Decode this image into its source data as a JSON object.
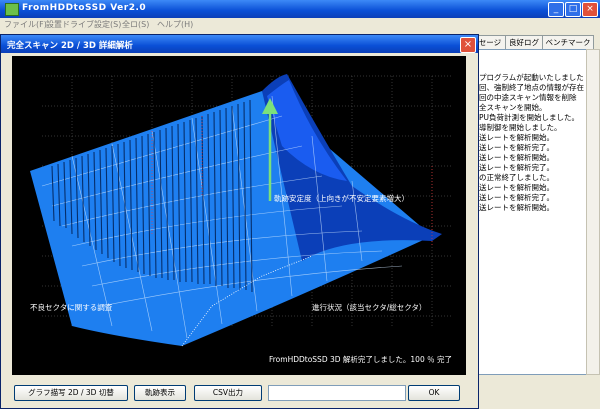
{
  "main_window": {
    "title": "FromHDDtoSSD Ver2.0",
    "menu": [
      "ファイル(F)",
      "設置ドライブ設定(S)",
      "全ロ(S)",
      "ヘルプ(H)"
    ],
    "minimize": "_",
    "maximize": "□",
    "close": "×"
  },
  "right_panel": {
    "tabs": [
      "セージ",
      "良好ログ",
      "ベンチマーク"
    ],
    "log_lines": [
      "プログラムが起動いたしました",
      "回、強制終了地点の情報が存在",
      "回の中途スキャン情報を削除",
      "全スキャンを開始。",
      "PU負荷計測を開始しました。",
      "導制御を開始しました。",
      "送レートを解析開始。",
      "送レートを解析完了。",
      "送レートを解析開始。",
      "送レートを解析完了。",
      "の正常終了しました。",
      "送レートを解析開始。",
      "送レートを解析完了。",
      "送レートを解析開始。"
    ]
  },
  "dialog": {
    "title": "完全スキャン 2D / 3D 詳細解析",
    "close": "×",
    "plot": {
      "arrow_label": "軌跡安定度（上向きが不安定要素増大）",
      "left_label": "不良セクタに関する調査",
      "right_label": "進行状況（該当セクタ/総セクタ）",
      "status": "FromHDDtoSSD 3D 解析完了しました。100 ％ 完了"
    },
    "buttons": {
      "toggle": "グラフ描写 2D / 3D 切替",
      "trace": "軌跡表示",
      "csv": "CSV出力",
      "ok": "OK"
    },
    "status_field": ""
  },
  "colors": {
    "surface": "#1e7ff0",
    "surface_dark": "#0b3fb8",
    "arrow": "#7be07b",
    "accent_blue": "#0a4fd6"
  }
}
